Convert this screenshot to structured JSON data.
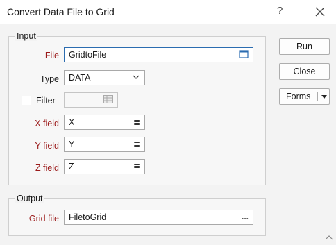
{
  "window": {
    "title": "Convert Data File to Grid",
    "help": "?",
    "close": "✕"
  },
  "input_group": {
    "label": "Input",
    "file": {
      "label": "File",
      "value": "GridtoFile"
    },
    "type": {
      "label": "Type",
      "value": "DATA"
    },
    "filter": {
      "label": "Filter",
      "value": ""
    },
    "x_field": {
      "label": "X field",
      "value": "X"
    },
    "y_field": {
      "label": "Y field",
      "value": "Y"
    },
    "z_field": {
      "label": "Z field",
      "value": "Z"
    }
  },
  "output_group": {
    "label": "Output",
    "grid_file": {
      "label": "Grid file",
      "value": "FiletoGrid",
      "browse": "..."
    }
  },
  "buttons": {
    "run": "Run",
    "close": "Close",
    "forms": "Forms"
  },
  "colors": {
    "required_label": "#9b1b1b",
    "accent_border": "#2b6cb0"
  }
}
